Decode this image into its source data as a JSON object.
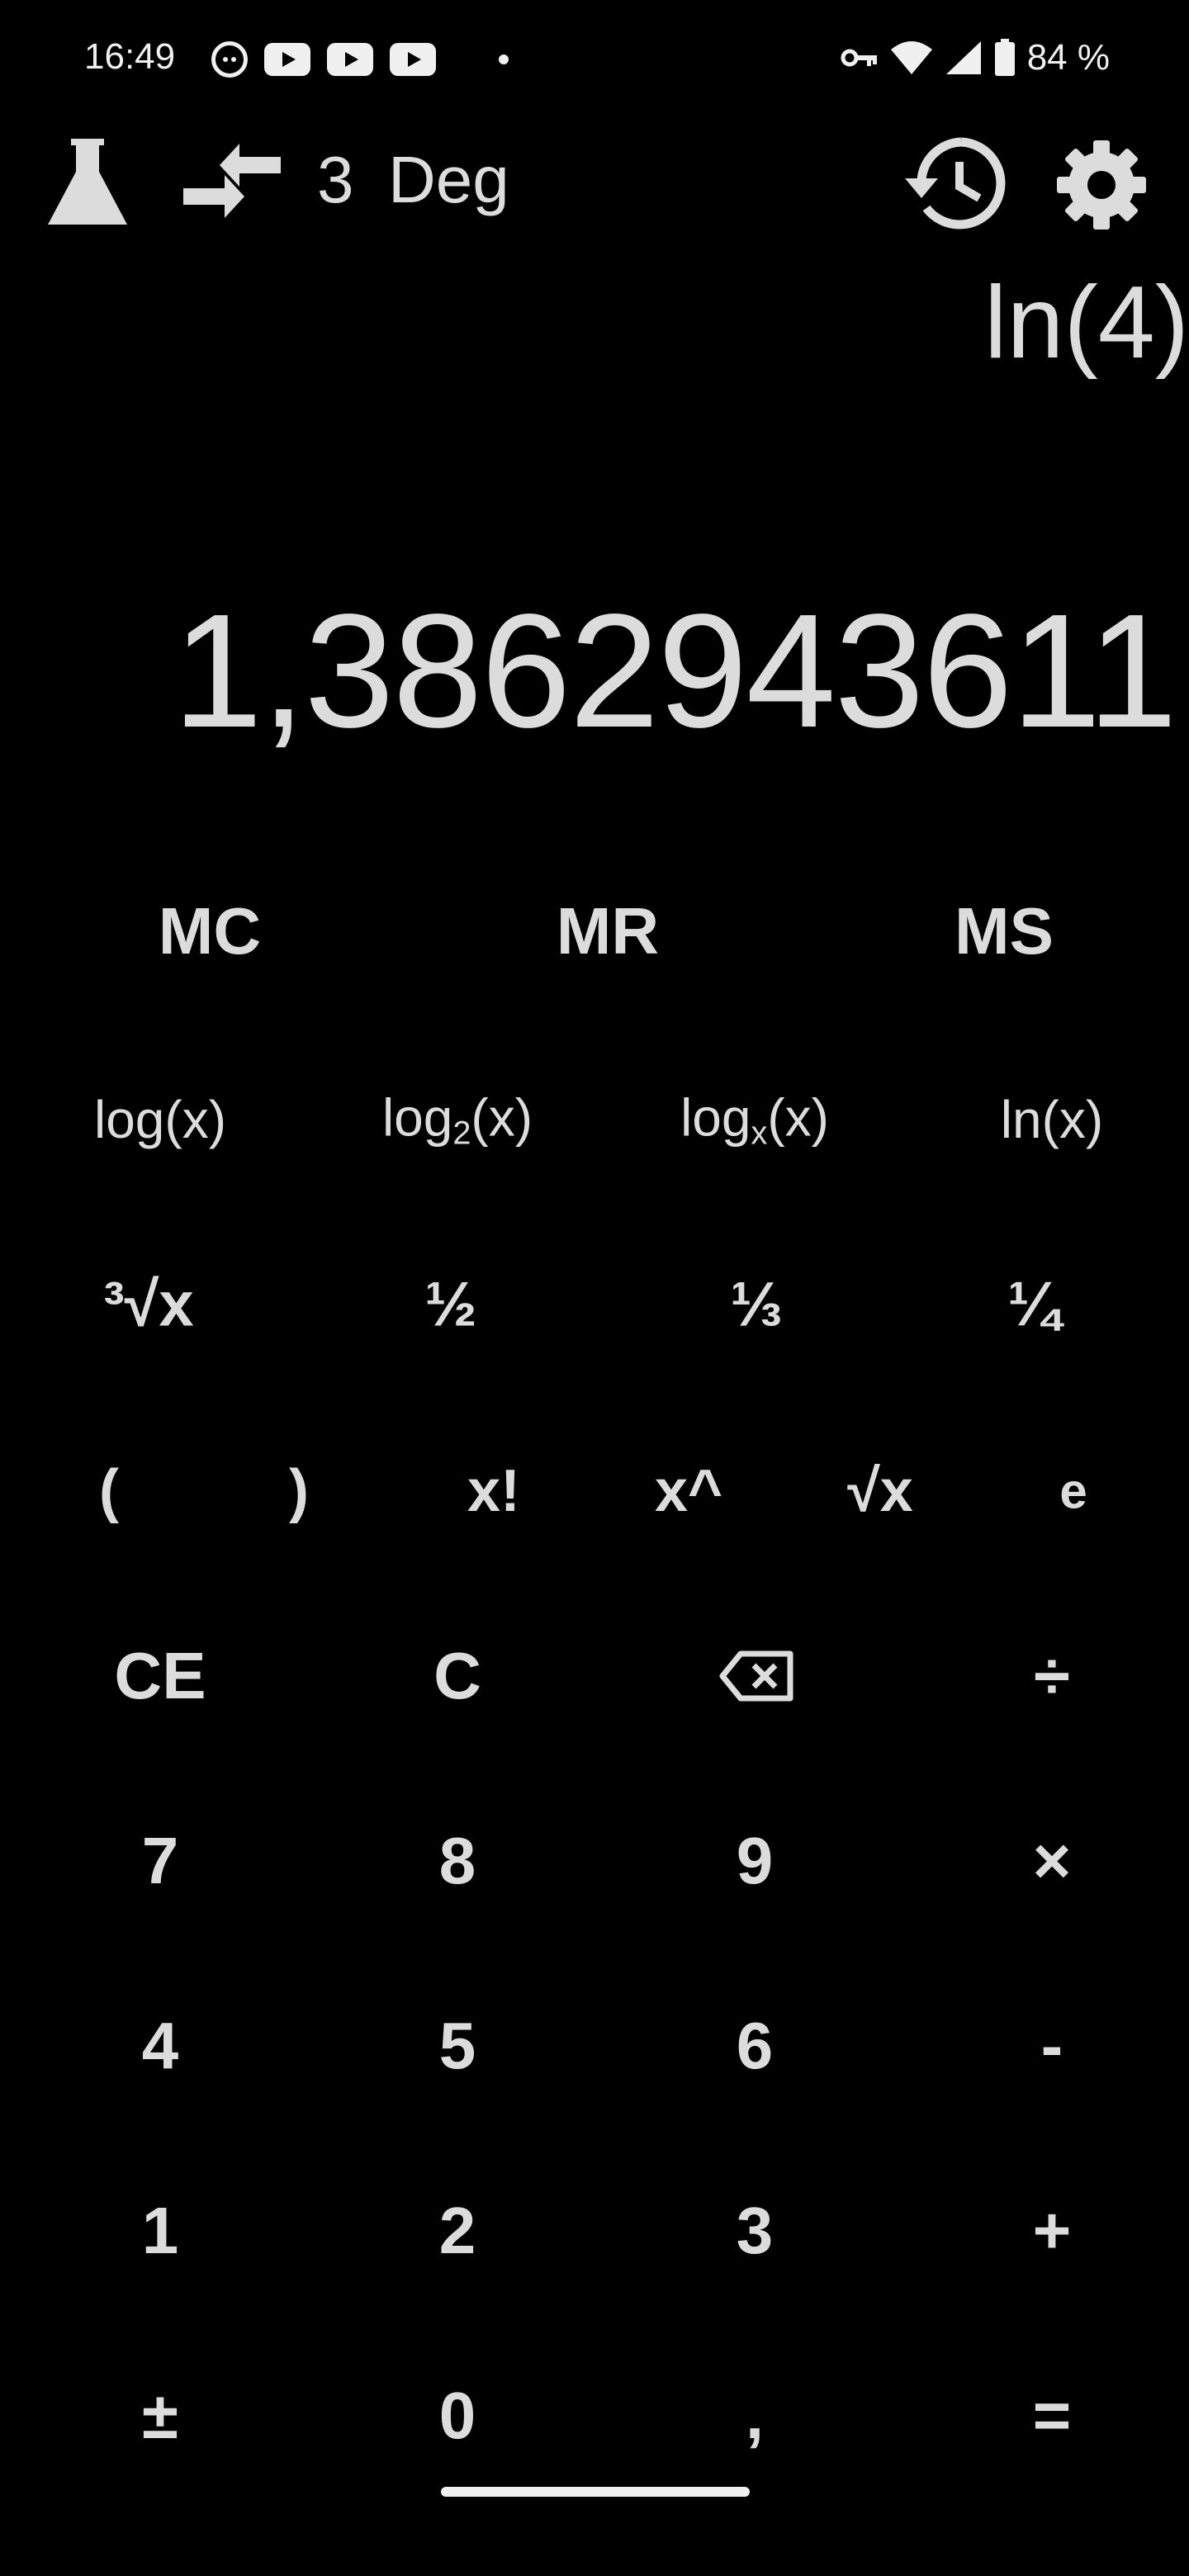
{
  "status_bar": {
    "time": "16:49",
    "battery": "84 %",
    "icons": [
      "cat-icon",
      "youtube-icon",
      "youtube-icon",
      "youtube-icon",
      "dot-icon",
      "key-icon",
      "wifi-icon",
      "signal-icon",
      "battery-icon"
    ]
  },
  "toolbar": {
    "precision": "3",
    "angle_mode": "Deg",
    "icons": [
      "flask-icon",
      "swap-arrows-icon",
      "history-icon",
      "settings-icon"
    ]
  },
  "display": {
    "expression": "ln(4)",
    "result": "1,3862943611"
  },
  "keypad": {
    "memory": [
      "MC",
      "MR",
      "MS"
    ],
    "logs": {
      "log": "log(x)",
      "log2_prefix": "log",
      "log2_sub": "2",
      "log2_suffix": "(x)",
      "logx_prefix": "log",
      "logx_sub": "x",
      "logx_suffix": "(x)",
      "ln": "ln(x)"
    },
    "roots": [
      "³√x",
      "½",
      "⅓",
      "¼"
    ],
    "ops": [
      "(",
      ")",
      "x!",
      "x^",
      "√x",
      "e"
    ],
    "edit": [
      "CE",
      "C",
      "÷"
    ],
    "row7": [
      "7",
      "8",
      "9",
      "×"
    ],
    "row4": [
      "4",
      "5",
      "6",
      "-"
    ],
    "row1": [
      "1",
      "2",
      "3",
      "+"
    ],
    "row0": [
      "±",
      "0",
      ",",
      "="
    ]
  },
  "colors": {
    "background": "#000000",
    "text": "#dcdcdc"
  }
}
